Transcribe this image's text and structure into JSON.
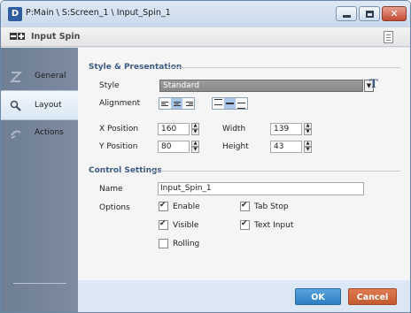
{
  "window": {
    "title": "P:Main \\ S:Screen_1 \\ Input_Spin_1",
    "app_icon": "D"
  },
  "header": {
    "title": "Input Spin"
  },
  "sidebar": {
    "items": [
      {
        "label": "General",
        "icon": "general-icon"
      },
      {
        "label": "Layout",
        "icon": "layout-icon",
        "active": true
      },
      {
        "label": "Actions",
        "icon": "actions-icon"
      }
    ]
  },
  "style_section": {
    "title": "Style & Presentation",
    "style_label": "Style",
    "style_value": "Standard",
    "alignment_label": "Alignment",
    "x_label": "X Position",
    "x_value": "160",
    "y_label": "Y Position",
    "y_value": "80",
    "width_label": "Width",
    "width_value": "139",
    "height_label": "Height",
    "height_value": "43"
  },
  "control_section": {
    "title": "Control Settings",
    "name_label": "Name",
    "name_value": "Input_Spin_1",
    "options_label": "Options",
    "options": {
      "enable": {
        "label": "Enable",
        "checked": true
      },
      "visible": {
        "label": "Visible",
        "checked": true
      },
      "rolling": {
        "label": "Rolling",
        "checked": false
      },
      "tab_stop": {
        "label": "Tab Stop",
        "checked": true
      },
      "text_input": {
        "label": "Text Input",
        "checked": true
      }
    }
  },
  "footer": {
    "ok_label": "OK",
    "cancel_label": "Cancel"
  },
  "colors": {
    "ok": "#2e7ec2",
    "cancel": "#c45a2f",
    "sidebar": "#7687a0",
    "section_title": "#3d5a85"
  }
}
